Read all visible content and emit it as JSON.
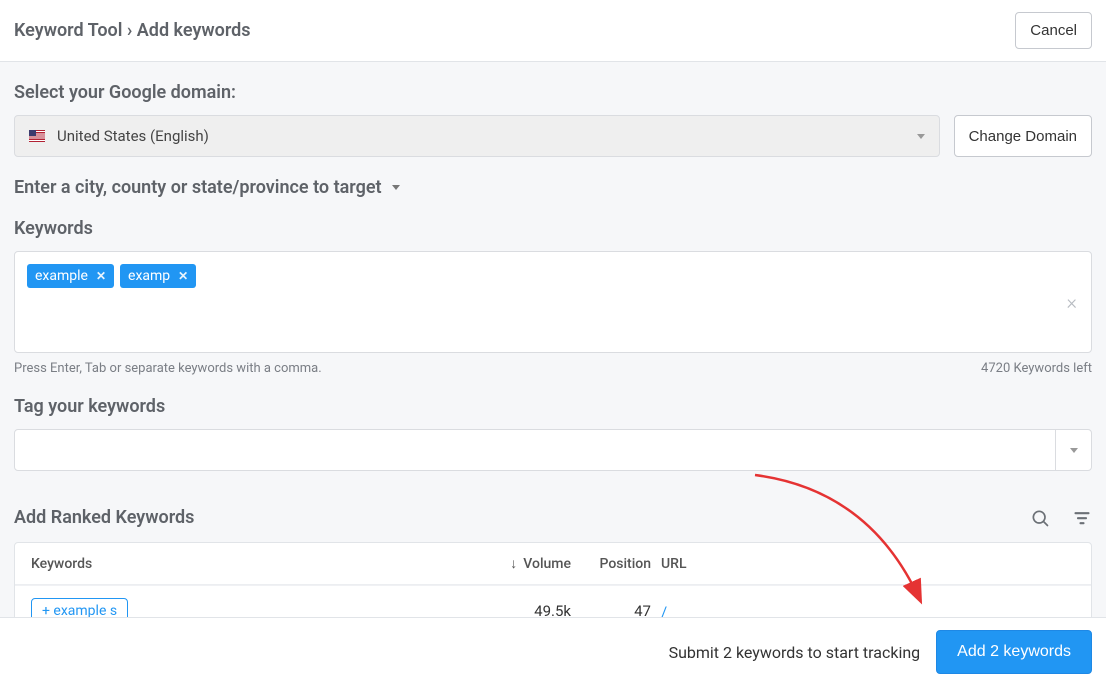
{
  "header": {
    "breadcrumb_tool": "Keyword Tool",
    "breadcrumb_sep": "›",
    "breadcrumb_page": "Add keywords",
    "cancel_label": "Cancel"
  },
  "domain": {
    "label": "Select your Google domain:",
    "selected": "United States (English)",
    "change_label": "Change Domain"
  },
  "location": {
    "label": "Enter a city, county or state/province to target"
  },
  "keywords": {
    "label": "Keywords",
    "tags": [
      "example",
      "examp"
    ],
    "helper": "Press Enter, Tab or separate keywords with a comma.",
    "remaining": "4720 Keywords left"
  },
  "tag_section": {
    "label": "Tag your keywords"
  },
  "ranked": {
    "label": "Add Ranked Keywords",
    "columns": {
      "keywords": "Keywords",
      "volume": "Volume",
      "position": "Position",
      "url": "URL"
    },
    "rows": [
      {
        "add_text": "example s",
        "volume": "49.5k",
        "position": "47",
        "url": "/"
      }
    ]
  },
  "footer": {
    "submit_text": "Submit 2 keywords to start tracking",
    "add_button": "Add 2 keywords"
  }
}
